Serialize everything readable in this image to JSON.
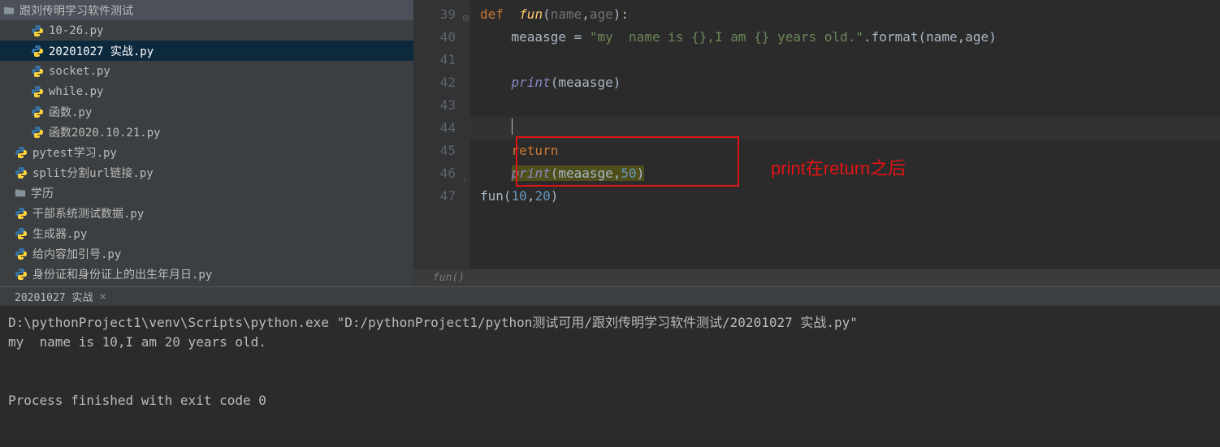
{
  "sidebar": {
    "root_label": "跟刘传明学习软件测试",
    "items": [
      {
        "label": "10-26.py",
        "level": 1,
        "type": "py",
        "selected": false
      },
      {
        "label": "20201027 实战.py",
        "level": 1,
        "type": "py",
        "selected": true
      },
      {
        "label": "socket.py",
        "level": 1,
        "type": "py",
        "selected": false
      },
      {
        "label": "while.py",
        "level": 1,
        "type": "py",
        "selected": false
      },
      {
        "label": "函数.py",
        "level": 1,
        "type": "py",
        "selected": false
      },
      {
        "label": "函数2020.10.21.py",
        "level": 1,
        "type": "py",
        "selected": false
      },
      {
        "label": "pytest学习.py",
        "level": 0,
        "type": "py",
        "selected": false
      },
      {
        "label": "split分割url链接.py",
        "level": 0,
        "type": "py",
        "selected": false
      },
      {
        "label": "学历",
        "level": 0,
        "type": "folder",
        "selected": false
      },
      {
        "label": "干部系统测试数据.py",
        "level": 0,
        "type": "py",
        "selected": false
      },
      {
        "label": "生成器.py",
        "level": 0,
        "type": "py",
        "selected": false
      },
      {
        "label": "给内容加引号.py",
        "level": 0,
        "type": "py",
        "selected": false
      },
      {
        "label": "身份证和身份证上的出生年月日.py",
        "level": 0,
        "type": "py",
        "selected": false
      }
    ]
  },
  "editor": {
    "line_numbers": [
      "39",
      "40",
      "41",
      "42",
      "43",
      "44",
      "45",
      "46",
      "47"
    ],
    "annotation_text": "print在return之后",
    "method_hint": "fun()",
    "code": {
      "l39": {
        "kw_def": "def",
        "fn_name": "fun",
        "p1": "name",
        "p2": "age"
      },
      "l40": {
        "var": "meaasge",
        "eq": " = ",
        "str": "\"my  name is {},I am {} years old.\"",
        "dot": ".",
        "fmt": "format",
        "a1": "name",
        "a2": "age"
      },
      "l42": {
        "call": "print",
        "arg": "meaasge"
      },
      "l45": {
        "kw": "return"
      },
      "l46": {
        "call": "print",
        "arg1": "meaasge",
        "arg2": "50"
      },
      "l47": {
        "fn": "fun",
        "a1": "10",
        "a2": "20"
      }
    }
  },
  "run_tab": {
    "label": "20201027 实战",
    "close_glyph": "×"
  },
  "console": {
    "line1": "D:\\pythonProject1\\venv\\Scripts\\python.exe \"D:/pythonProject1/python测试可用/跟刘传明学习软件测试/20201027 实战.py\"",
    "line2": "my  name is 10,I am 20 years old.",
    "line3": "",
    "line4": "",
    "line5": "Process finished with exit code 0"
  }
}
